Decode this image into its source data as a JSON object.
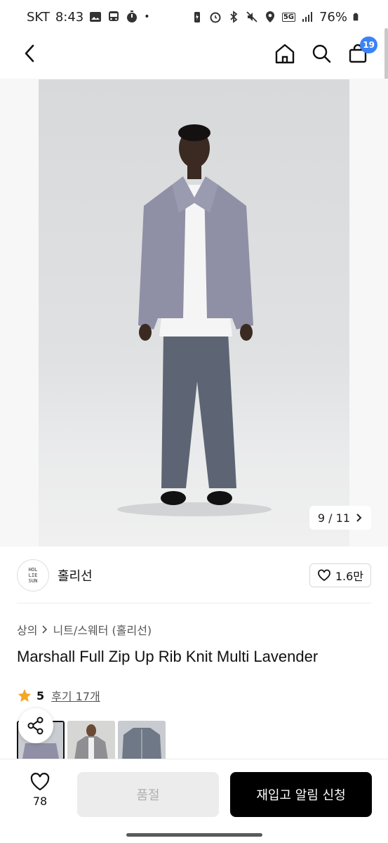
{
  "status_bar": {
    "carrier": "SKT",
    "time": "8:43",
    "battery": "76%",
    "network": "5G"
  },
  "header": {
    "cart_count": "19"
  },
  "hero": {
    "counter": "9 / 11",
    "colors": {
      "backdrop": "#dcdedf",
      "sweater": "#8f8fa6",
      "pants": "#5d6574",
      "shirt": "#f5f5f5",
      "skin": "#3a2a22"
    }
  },
  "brand": {
    "logo_text_1": "HOL",
    "logo_text_2": "LIE",
    "logo_text_3": "SUN",
    "name": "홀리선",
    "likes": "1.6만"
  },
  "product": {
    "breadcrumb_category": "상의",
    "breadcrumb_sub": "니트/스웨터 (홀리선)",
    "title": "Marshall Full Zip Up Rib Knit Multi Lavender",
    "rating": "5",
    "reviews": "후기 17개",
    "star_color": "#f5a623"
  },
  "bottom_bar": {
    "wish_count": "78",
    "soldout_label": "품절",
    "notify_label": "재입고 알림 신청"
  }
}
